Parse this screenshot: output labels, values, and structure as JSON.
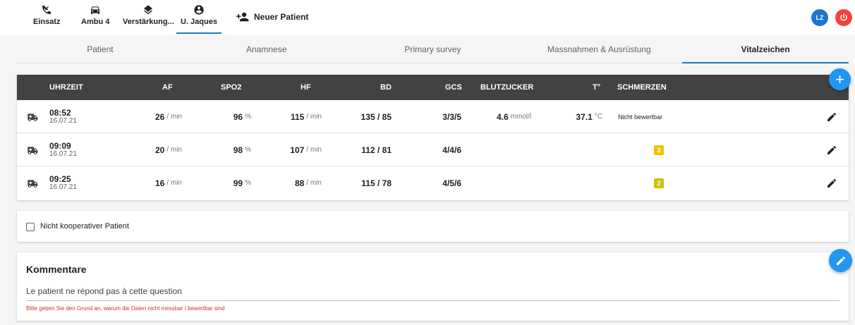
{
  "topnav": {
    "items": [
      {
        "label": "Einsatz",
        "icon": "phone-icon"
      },
      {
        "label": "Ambu 4",
        "icon": "car-icon"
      },
      {
        "label": "Verstärkung...",
        "icon": "layers-icon"
      },
      {
        "label": "U. Jaques",
        "icon": "account-circle-icon"
      }
    ],
    "active_index": 3,
    "new_patient": "Neuer Patient",
    "avatar_initials": "LZ"
  },
  "tabs": [
    "Patient",
    "Anamnese",
    "Primary survey",
    "Massnahmen & Ausrüstung",
    "Vitalzeichen"
  ],
  "active_tab": "Vitalzeichen",
  "table": {
    "headers": {
      "time": "UHRZEIT",
      "af": "AF",
      "spo2": "SPO2",
      "hf": "HF",
      "bd": "BD",
      "gcs": "GCS",
      "bz": "BLUTZUCKER",
      "temp": "T°",
      "pain": "SCHMERZEN"
    },
    "rows": [
      {
        "time": "08:52",
        "date": "16.07.21",
        "af": "26",
        "af_unit": "/ min",
        "spo2": "96",
        "spo2_unit": "%",
        "hf": "115",
        "hf_unit": "/ min",
        "bd": "135 / 85",
        "gcs": "3/3/5",
        "bz": "4.6",
        "bz_unit": "mmol/l",
        "temp": "37.1",
        "temp_unit": "°C",
        "pain": "Nicht bewertbar"
      },
      {
        "time": "09:09",
        "date": "16.07.21",
        "af": "20",
        "af_unit": "/ min",
        "spo2": "98",
        "spo2_unit": "%",
        "hf": "107",
        "hf_unit": "/ min",
        "bd": "112 / 81",
        "gcs": "4/4/6",
        "bz": "",
        "bz_unit": "",
        "temp": "",
        "temp_unit": "",
        "pain": "3"
      },
      {
        "time": "09:25",
        "date": "16.07.21",
        "af": "16",
        "af_unit": "/ min",
        "spo2": "99",
        "spo2_unit": "%",
        "hf": "88",
        "hf_unit": "/ min",
        "bd": "115 / 78",
        "gcs": "4/5/6",
        "bz": "",
        "bz_unit": "",
        "temp": "",
        "temp_unit": "",
        "pain": "2"
      }
    ]
  },
  "checkbox": {
    "label": "Nicht kooperativer Patient",
    "checked": false
  },
  "comments": {
    "title": "Kommentare",
    "text": "Le patient ne répond pas à cette question",
    "error": "Bitte geben Sie den Grund an, warum die Daten nicht messbar / bewertbar sind"
  },
  "colors": {
    "accent": "#1976d2",
    "fab": "#2196f3",
    "danger": "#f44336",
    "header_bg": "#424242",
    "pain_3": "#f2c200",
    "pain_2": "#c6c600"
  }
}
